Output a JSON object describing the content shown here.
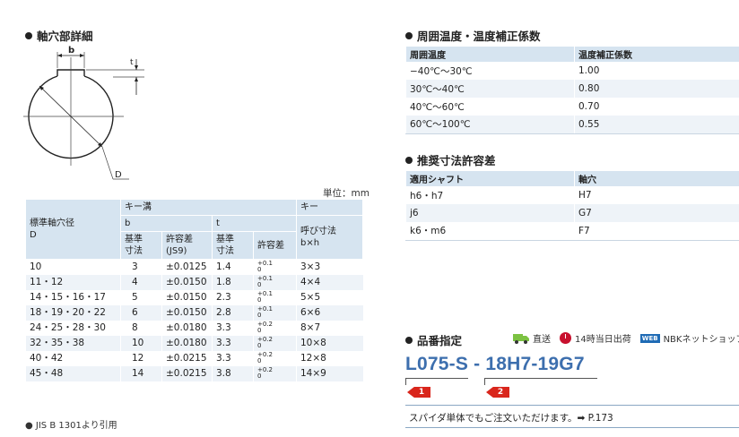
{
  "left": {
    "section_title": "軸穴部詳細",
    "diagram": {
      "label_b": "b",
      "label_t": "t",
      "label_d": "D"
    },
    "unit": "単位：mm",
    "key_table": {
      "header_keyway": "キー溝",
      "header_key": "キー",
      "header_shaft": "標準軸穴径",
      "header_shaft_d": "D",
      "header_b": "b",
      "header_t": "t",
      "header_basic": "基準",
      "header_size": "寸法",
      "header_tol": "許容差",
      "header_js9": "(JS9)",
      "header_tol2": "許容差",
      "header_nominal": "呼び寸法",
      "header_bxh": "b×h",
      "rows": [
        {
          "d": "10",
          "b": "3",
          "b_tol": "±0.0125",
          "t": "1.4",
          "t_up": "+0.1",
          "t_lo": "0",
          "key": "3×3"
        },
        {
          "d": "11・12",
          "b": "4",
          "b_tol": "±0.0150",
          "t": "1.8",
          "t_up": "+0.1",
          "t_lo": "0",
          "key": "4×4"
        },
        {
          "d": "14・15・16・17",
          "b": "5",
          "b_tol": "±0.0150",
          "t": "2.3",
          "t_up": "+0.1",
          "t_lo": "0",
          "key": "5×5"
        },
        {
          "d": "18・19・20・22",
          "b": "6",
          "b_tol": "±0.0150",
          "t": "2.8",
          "t_up": "+0.1",
          "t_lo": "0",
          "key": "6×6"
        },
        {
          "d": "24・25・28・30",
          "b": "8",
          "b_tol": "±0.0180",
          "t": "3.3",
          "t_up": "+0.2",
          "t_lo": "0",
          "key": "8×7"
        },
        {
          "d": "32・35・38",
          "b": "10",
          "b_tol": "±0.0180",
          "t": "3.3",
          "t_up": "+0.2",
          "t_lo": "0",
          "key": "10×8"
        },
        {
          "d": "40・42",
          "b": "12",
          "b_tol": "±0.0215",
          "t": "3.3",
          "t_up": "+0.2",
          "t_lo": "0",
          "key": "12×8"
        },
        {
          "d": "45・48",
          "b": "14",
          "b_tol": "±0.0215",
          "t": "3.8",
          "t_up": "+0.2",
          "t_lo": "0",
          "key": "14×9"
        }
      ]
    },
    "note": "● JIS B 1301より引用"
  },
  "right": {
    "temp_title": "周囲温度・温度補正係数",
    "temp_table": {
      "h1": "周囲温度",
      "h2": "温度補正係数",
      "rows": [
        {
          "temp": "−40℃〜30℃",
          "coef": "1.00"
        },
        {
          "temp": "30℃〜40℃",
          "coef": "0.80"
        },
        {
          "temp": "40℃〜60℃",
          "coef": "0.70"
        },
        {
          "temp": "60℃〜100℃",
          "coef": "0.55"
        }
      ]
    },
    "tol_title": "推奨寸法許容差",
    "tol_table": {
      "h1": "適用シャフト",
      "h2": "軸穴",
      "rows": [
        {
          "shaft": "h6・h7",
          "hole": "H7"
        },
        {
          "shaft": "j6",
          "hole": "G7"
        },
        {
          "shaft": "k6・m6",
          "hole": "F7"
        }
      ]
    },
    "part_title": "品番指定",
    "tags": {
      "direct": "直送",
      "same_day": "14時当日出荷",
      "web_badge": "WEB",
      "net_shop": "NBKネットショップ"
    },
    "part_number": "L075-S - 18H7-19G7",
    "marker1": "1",
    "marker2": "2",
    "footer": "スパイダ単体でもご注文いただけます。➡ P.173",
    "colors": {
      "accent": "#3d6fae",
      "header_bg": "#d6e4f0",
      "marker": "#d9261c"
    }
  }
}
